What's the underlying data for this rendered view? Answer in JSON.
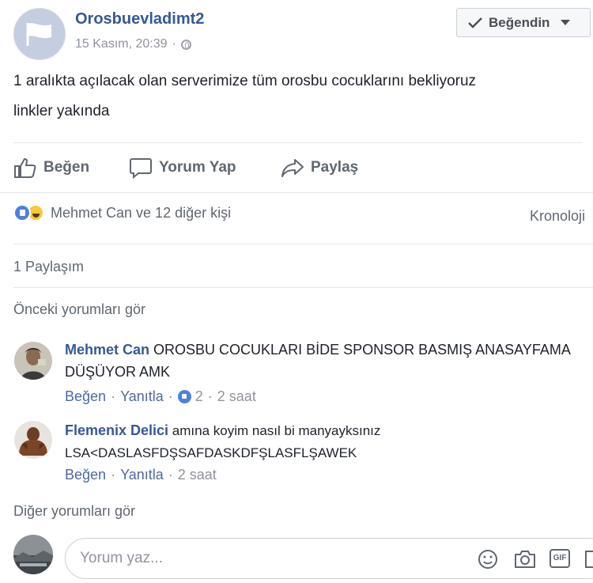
{
  "post": {
    "page_name": "Orosbuevladimt2",
    "timestamp": "15 Kasım, 20:39",
    "liked_button": "Beğendin",
    "text_line1": "1 aralıkta açılacak olan serverimize tüm orosbu cocuklarını bekliyoruz",
    "text_line2": "linkler yakında"
  },
  "actions": {
    "like": "Beğen",
    "comment": "Yorum Yap",
    "share": "Paylaş"
  },
  "reactions": {
    "summary": "Mehmet Can ve 12 diğer kişi",
    "icons": [
      "like-reaction-icon",
      "haha-reaction-icon"
    ],
    "sort": "Kronoloji"
  },
  "shares": "1 Paylaşım",
  "previous_comments": "Önceki yorumları gör",
  "comments": [
    {
      "author": "Mehmet Can",
      "text": "OROSBU COCUKLARI BİDE SPONSOR BASMIŞ ANASAYFAMA DÜŞÜYOR AMK",
      "like": "Beğen",
      "reply": "Yanıtla",
      "like_count": "2",
      "time": "2 saat"
    },
    {
      "author": "Flemenix Delici",
      "text": "amına koyim nasıl bi manyayksınız LSA<DASLASFDŞSAFDASKDFŞLASFLŞAWEK",
      "like": "Beğen",
      "reply": "Yanıtla",
      "time": "2 saat"
    }
  ],
  "more_comments": "Diğer yorumları gör",
  "composer": {
    "placeholder": "Yorum yaz...",
    "tools": [
      "emoji-icon",
      "camera-icon",
      "gif-icon",
      "sticker-icon"
    ],
    "gif_label": "GIF"
  },
  "colors": {
    "link_blue": "#365899",
    "like_blue": "#4e7fe0",
    "muted_text": "#90949c"
  }
}
